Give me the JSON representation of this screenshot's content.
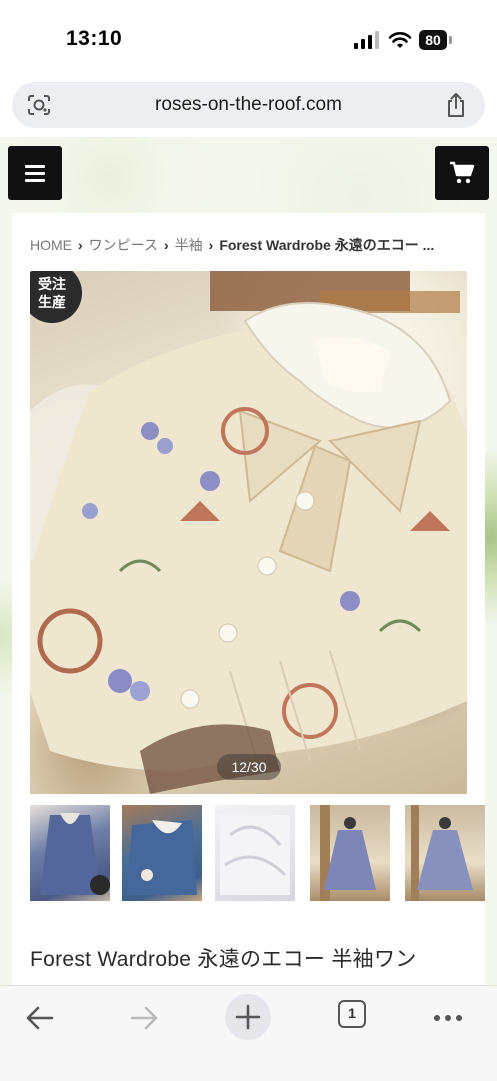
{
  "status_bar": {
    "time": "13:10",
    "battery": "80"
  },
  "browser": {
    "url": "roses-on-the-roof.com",
    "tab_count": "1"
  },
  "breadcrumb": {
    "items": [
      "HOME",
      "ワンピース",
      "半袖"
    ],
    "current": "Forest Wardrobe 永遠のエコー ..."
  },
  "product": {
    "badge_line1": "受注",
    "badge_line2": "生産",
    "image_counter": "12/30",
    "title": "Forest Wardrobe 永遠のエコー 半袖ワン"
  },
  "colors": {
    "header_button": "#111111",
    "badge": "#2b2b2b",
    "background": "#f4f7ee"
  },
  "icons": [
    "menu-icon",
    "cart-icon",
    "lens-icon",
    "share-icon",
    "back-icon",
    "forward-icon",
    "plus-icon",
    "more-icon"
  ]
}
